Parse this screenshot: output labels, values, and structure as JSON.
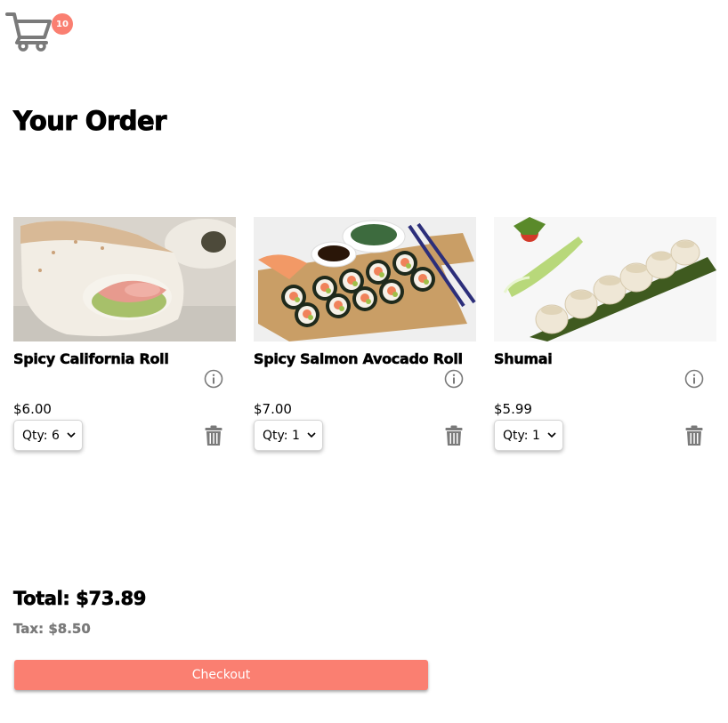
{
  "header": {
    "cart_icon": "shopping-cart-icon",
    "cart_count": "10",
    "badge_color": "#fa7f71"
  },
  "page": {
    "title": "Your Order"
  },
  "items": [
    {
      "name": "Spicy California Roll",
      "price": "$6.00",
      "qty_label": "Qty: 6"
    },
    {
      "name": "Spicy Salmon Avocado Roll",
      "price": "$7.00",
      "qty_label": "Qty: 1"
    },
    {
      "name": "Shumai",
      "price": "$5.99",
      "qty_label": "Qty: 1"
    }
  ],
  "summary": {
    "total": "Total: $73.89",
    "tax": "Tax: $8.50"
  },
  "checkout": {
    "label": "Checkout",
    "color": "#fa7f71"
  },
  "icons": {
    "info": "info-circle-icon",
    "delete": "trash-icon",
    "select": "chevron-down-icon"
  }
}
